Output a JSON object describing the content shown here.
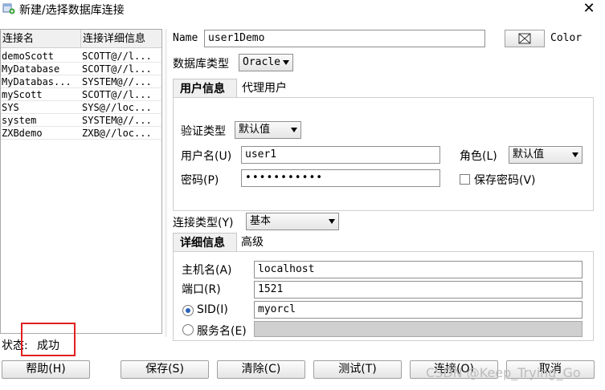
{
  "window": {
    "title": "新建/选择数据库连接",
    "close_icon": "✕"
  },
  "connections": {
    "columns": [
      "连接名",
      "连接详细信息"
    ],
    "rows": [
      [
        "demoScott",
        "SCOTT@//l..."
      ],
      [
        "MyDatabase",
        "SCOTT@//l..."
      ],
      [
        "MyDatabas...",
        "SYSTEM@//..."
      ],
      [
        "myScott",
        "SCOTT@//l..."
      ],
      [
        "SYS",
        "SYS@//loc..."
      ],
      [
        "system",
        "SYSTEM@//..."
      ],
      [
        "ZXBdemo",
        "ZXB@//loc..."
      ]
    ]
  },
  "form": {
    "name_label": "Name",
    "name_value": "user1Demo",
    "color_label": "Color",
    "db_type_label": "数据库类型",
    "db_type_value": "Oracle",
    "tabs1": [
      "用户信息",
      "代理用户"
    ],
    "auth_type_label": "验证类型",
    "auth_type_value": "默认值",
    "username_label": "用户名(U)",
    "username_value": "user1",
    "role_label": "角色(L)",
    "role_value": "默认值",
    "password_label": "密码(P)",
    "password_value": "•••••••••••",
    "save_password_label": "保存密码(V)",
    "conn_type_label": "连接类型(Y)",
    "conn_type_value": "基本",
    "tabs2": [
      "详细信息",
      "高级"
    ],
    "host_label": "主机名(A)",
    "host_value": "localhost",
    "port_label": "端口(R)",
    "port_value": "1521",
    "sid_label": "SID(I)",
    "sid_value": "myorcl",
    "service_label": "服务名(E)",
    "service_value": ""
  },
  "status": {
    "label": "状态:",
    "value": "成功"
  },
  "buttons": {
    "help": "帮助(H)",
    "save": "保存(S)",
    "clear": "清除(C)",
    "test": "测试(T)",
    "connect": "连接(O)",
    "cancel": "取消"
  },
  "watermark": "CSDN @Keep_Trying_Go"
}
